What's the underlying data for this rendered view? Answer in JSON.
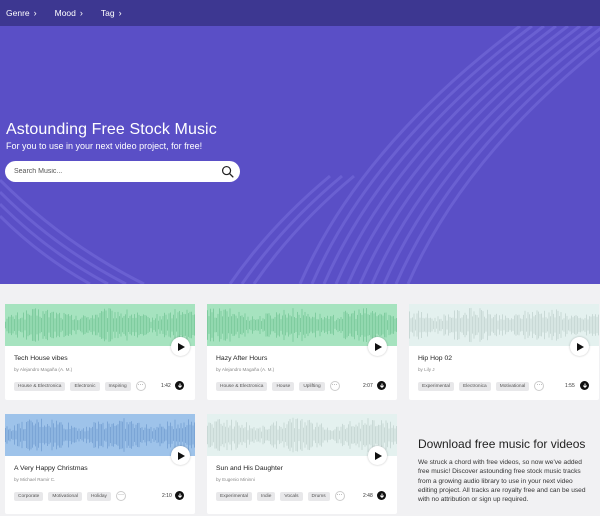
{
  "nav": {
    "items": [
      {
        "label": "Genre"
      },
      {
        "label": "Mood"
      },
      {
        "label": "Tag"
      }
    ]
  },
  "hero": {
    "title": "Astounding Free Stock Music",
    "subtitle": "For you to use in your next video project, for free!",
    "search_placeholder": "Search Music...",
    "background": "#5a4fc6"
  },
  "tracks": [
    {
      "title": "Tech House vibes",
      "author": "by Alejandro Magaña (A. M.)",
      "tags": [
        "House & Electronica",
        "Electronic",
        "Inspiring"
      ],
      "more": "···",
      "duration": "1:42",
      "wave_bg": "#a6e3bf",
      "wave_color": "#7fcc9f"
    },
    {
      "title": "Hazy After Hours",
      "author": "by Alejandro Magaña (A. M.)",
      "tags": [
        "House & Electronica",
        "House",
        "Uplifting"
      ],
      "more": "···",
      "duration": "2:07",
      "wave_bg": "#a6e3bf",
      "wave_color": "#7fcc9f"
    },
    {
      "title": "Hip Hop 02",
      "author": "by Lily J",
      "tags": [
        "Experimental",
        "Electronica",
        "Motivational"
      ],
      "more": "···",
      "duration": "1:55",
      "wave_bg": "#e4f1ef",
      "wave_color": "#c9d9d6"
    },
    {
      "title": "A Very Happy Christmas",
      "author": "by Michael Ramir C.",
      "tags": [
        "Corporate",
        "Motivational",
        "Holiday"
      ],
      "more": "···",
      "duration": "2:10",
      "wave_bg": "#9ec3ea",
      "wave_color": "#7ba5d6"
    },
    {
      "title": "Sun and His Daughter",
      "author": "by Eugenio Mininni",
      "tags": [
        "Experimental",
        "Indie",
        "Vocals",
        "Drums"
      ],
      "more": "···",
      "duration": "2:48",
      "wave_bg": "#e4f1ef",
      "wave_color": "#c9d9d6"
    }
  ],
  "promo": {
    "title": "Download free music for videos",
    "text": "We struck a chord with free videos, so now we've added free music! Discover astounding free stock music tracks from a growing audio library to use in your next video editing project. All tracks are royalty free and can be used with no attribution or sign up required."
  }
}
